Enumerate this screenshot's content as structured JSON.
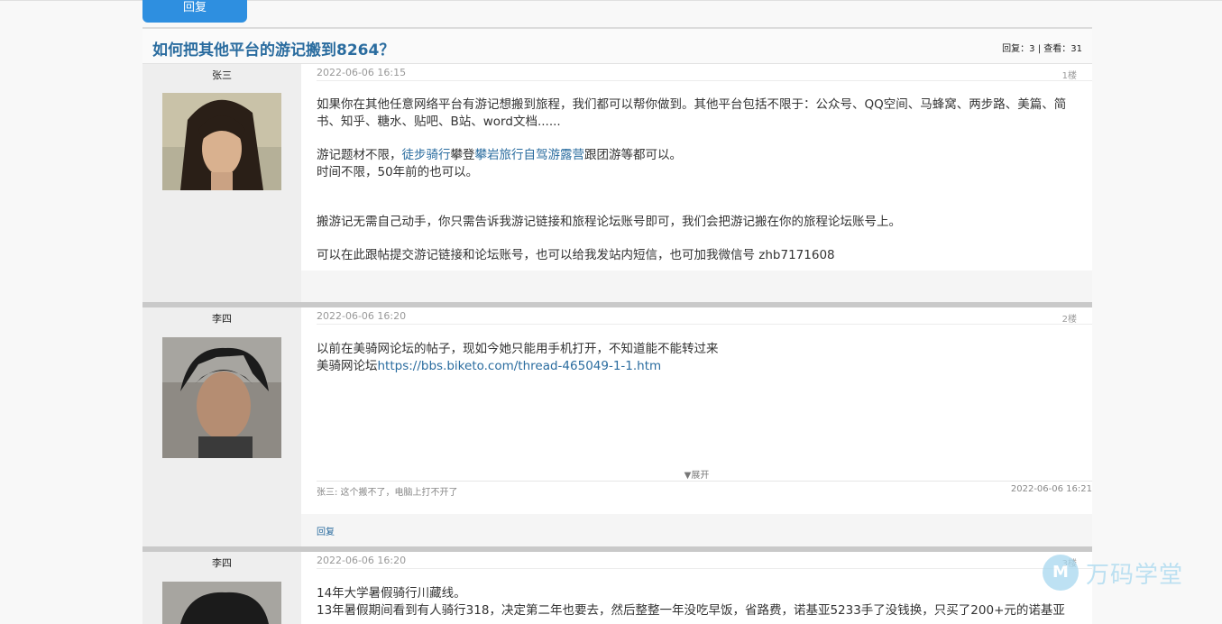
{
  "top_reply_button": "回复",
  "thread": {
    "title": "如何把其他平台的游记搬到8264？",
    "stats": "回复：3 | 查看：31"
  },
  "posts": [
    {
      "author": "张三",
      "time": "2022-06-06   16:15",
      "floor": "1楼",
      "paragraphs": [
        "如果你在其他任意网络平台有游记想搬到旅程，我们都可以帮你做到。其他平台包括不限于：公众号、QQ空间、马蜂窝、两步路、美篇、简书、知乎、糖水、贴吧、B站、word文档......",
        "",
        "时间不限，50年前的也可以。",
        "搬游记无需自己动手，你只需告诉我游记链接和旅程论坛账号即可，我们会把游记搬在你的旅程论坛账号上。",
        "可以在此跟帖提交游记链接和论坛账号，也可以给我发站内短信，也可加我微信号 zhb7171608"
      ],
      "topics_line": {
        "prefix": "游记题材不限，",
        "link1": "徒步骑行",
        "mid": "攀登",
        "link2": "攀岩旅行自驾游露营",
        "suffix": "跟团游等都可以。"
      }
    },
    {
      "author": "李四",
      "time": "2022-06-06   16:20",
      "floor": "2楼",
      "line1": "以前在美骑网论坛的帖子，现如今她只能用手机打开，不知道能不能转过来",
      "line2_prefix": "美骑网论坛",
      "line2_link": "https://bbs.biketo.com/thread-465049-1-1.htm",
      "expand": "▼展开",
      "comment": "张三: 这个搬不了，电脑上打不开了",
      "comment_time": "2022-06-06   16:21",
      "reply": "回复"
    },
    {
      "author": "李四",
      "time": "2022-06-06   16:20",
      "floor": "3楼",
      "line1": "14年大学暑假骑行川藏线。",
      "line2": "13年暑假期间看到有人骑行318，决定第二年也要去，然后整整一年没吃早饭，省路费，诺基亚5233手了没钱换，只买了200+元的诺基亚"
    }
  ],
  "watermark": {
    "logo_glyph": "M",
    "text": "万码学堂"
  }
}
